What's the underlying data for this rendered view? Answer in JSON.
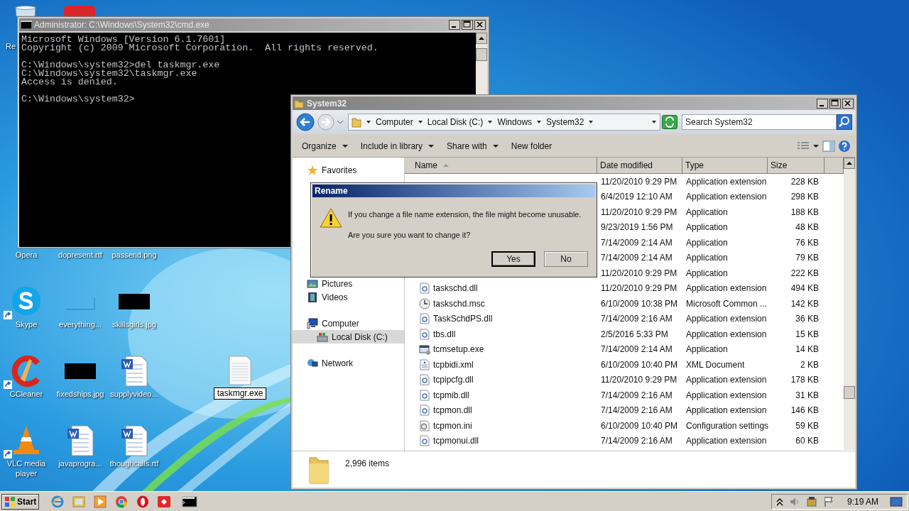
{
  "desktop": {
    "partial_label": "Re",
    "icons": [
      {
        "label": "Opera",
        "kind": "hidden",
        "shortcut": false
      },
      {
        "label": "dopresent.rtf",
        "kind": "hidden",
        "shortcut": false
      },
      {
        "label": "passend.png",
        "kind": "hidden",
        "shortcut": false
      },
      {
        "label": "Skype",
        "kind": "skype",
        "shortcut": true
      },
      {
        "label": "everything...",
        "kind": "blank-image",
        "shortcut": false
      },
      {
        "label": "skillsgirls.jpg",
        "kind": "black-image",
        "shortcut": false
      },
      {
        "label": "CCleaner",
        "kind": "ccleaner",
        "shortcut": true
      },
      {
        "label": "fixedships.jpg",
        "kind": "black-image",
        "shortcut": false
      },
      {
        "label": "supplyvideo...",
        "kind": "word",
        "shortcut": false
      },
      {
        "label": "VLC media player",
        "kind": "vlc",
        "shortcut": true
      },
      {
        "label": "javaprogra...",
        "kind": "word",
        "shortcut": false
      },
      {
        "label": "thoughcalls.rtf",
        "kind": "word",
        "shortcut": false
      }
    ],
    "renaming": {
      "label": "taskmgr.exe"
    }
  },
  "cmd": {
    "title": "Administrator: C:\\Windows\\System32\\cmd.exe",
    "paragraphs": [
      [
        "Microsoft Windows [Version 6.1.7601]",
        "Copyright (c) 2009 Microsoft Corporation.  All rights reserved."
      ],
      [
        "C:\\Windows\\system32>del taskmgr.exe",
        "C:\\Windows\\system32\\taskmgr.exe",
        "Access is denied."
      ],
      [
        "C:\\Windows\\system32>"
      ]
    ]
  },
  "explorer": {
    "title": "System32",
    "breadcrumb": [
      "Computer",
      "Local Disk (C:)",
      "Windows",
      "System32"
    ],
    "search": {
      "placeholder": "Search System32"
    },
    "toolbar": [
      {
        "label": "Organize",
        "menu": true
      },
      {
        "label": "Include in library",
        "menu": true
      },
      {
        "label": "Share with",
        "menu": true
      },
      {
        "label": "New folder",
        "menu": false
      }
    ],
    "nav_groups": [
      {
        "items": [
          {
            "label": "Favorites",
            "kind": "star",
            "selected": false
          }
        ]
      },
      {
        "items": [
          {
            "label": "Pictures",
            "kind": "pictures",
            "selected": false
          },
          {
            "label": "Videos",
            "kind": "videos",
            "selected": false
          }
        ]
      },
      {
        "items": [
          {
            "label": "Computer",
            "kind": "computer",
            "selected": false,
            "children": [
              {
                "label": "Local Disk (C:)",
                "kind": "disk",
                "selected": true
              }
            ]
          }
        ]
      },
      {
        "items": [
          {
            "label": "Network",
            "kind": "network",
            "selected": false
          }
        ]
      }
    ],
    "columns": [
      {
        "label": "Name",
        "sorted": true
      },
      {
        "label": "Date modified",
        "sorted": false
      },
      {
        "label": "Type",
        "sorted": false
      },
      {
        "label": "Size",
        "sorted": false
      }
    ],
    "files": [
      {
        "date": "11/20/2010 9:29 PM",
        "type": "Application extension",
        "size": "228 KB"
      },
      {
        "date": "6/4/2019 12:10 AM",
        "type": "Application extension",
        "size": "298 KB"
      },
      {
        "date": "11/20/2010 9:29 PM",
        "type": "Application",
        "size": "188 KB"
      },
      {
        "date": "9/23/2019 1:56 PM",
        "type": "Application",
        "size": "48 KB"
      },
      {
        "date": "7/14/2009 2:14 AM",
        "type": "Application",
        "size": "76 KB"
      },
      {
        "date": "7/14/2009 2:14 AM",
        "type": "Application",
        "size": "79 KB"
      },
      {
        "date": "11/20/2010 9:29 PM",
        "type": "Application",
        "size": "222 KB"
      },
      {
        "name": "taskschd.dll",
        "kind": "dll",
        "date": "11/20/2010 9:29 PM",
        "type": "Application extension",
        "size": "494 KB"
      },
      {
        "name": "taskschd.msc",
        "kind": "msc",
        "date": "6/10/2009 10:38 PM",
        "type": "Microsoft Common ...",
        "size": "142 KB"
      },
      {
        "name": "TaskSchdPS.dll",
        "kind": "dll",
        "date": "7/14/2009 2:16 AM",
        "type": "Application extension",
        "size": "36 KB"
      },
      {
        "name": "tbs.dll",
        "kind": "dll",
        "date": "2/5/2016 5:33 PM",
        "type": "Application extension",
        "size": "15 KB"
      },
      {
        "name": "tcmsetup.exe",
        "kind": "exe",
        "date": "7/14/2009 2:14 AM",
        "type": "Application",
        "size": "14 KB"
      },
      {
        "name": "tcpbidi.xml",
        "kind": "xml",
        "date": "6/10/2009 10:40 PM",
        "type": "XML Document",
        "size": "2 KB"
      },
      {
        "name": "tcpipcfg.dll",
        "kind": "dll",
        "date": "11/20/2010 9:29 PM",
        "type": "Application extension",
        "size": "178 KB"
      },
      {
        "name": "tcpmib.dll",
        "kind": "dll",
        "date": "7/14/2009 2:16 AM",
        "type": "Application extension",
        "size": "31 KB"
      },
      {
        "name": "tcpmon.dll",
        "kind": "dll",
        "date": "7/14/2009 2:16 AM",
        "type": "Application extension",
        "size": "146 KB"
      },
      {
        "name": "tcpmon.ini",
        "kind": "ini",
        "date": "6/10/2009 10:40 PM",
        "type": "Configuration settings",
        "size": "59 KB"
      },
      {
        "name": "tcpmonui.dll",
        "kind": "dll",
        "date": "7/14/2009 2:16 AM",
        "type": "Application extension",
        "size": "60 KB"
      }
    ],
    "status": "2,996 items"
  },
  "dialog": {
    "title": "Rename",
    "message": "If you change a file name extension, the file might become unusable.",
    "question": "Are you sure you want to change it?",
    "buttons": [
      {
        "label": "Yes",
        "default": true
      },
      {
        "label": "No",
        "default": false
      }
    ]
  },
  "taskbar": {
    "start": "Start",
    "apps": [
      {
        "kind": "ie"
      },
      {
        "kind": "explorer"
      },
      {
        "kind": "media"
      },
      {
        "kind": "chrome"
      },
      {
        "kind": "opera"
      },
      {
        "kind": "red-app"
      },
      {
        "kind": "cmd"
      }
    ],
    "clock": "9:19 AM"
  }
}
